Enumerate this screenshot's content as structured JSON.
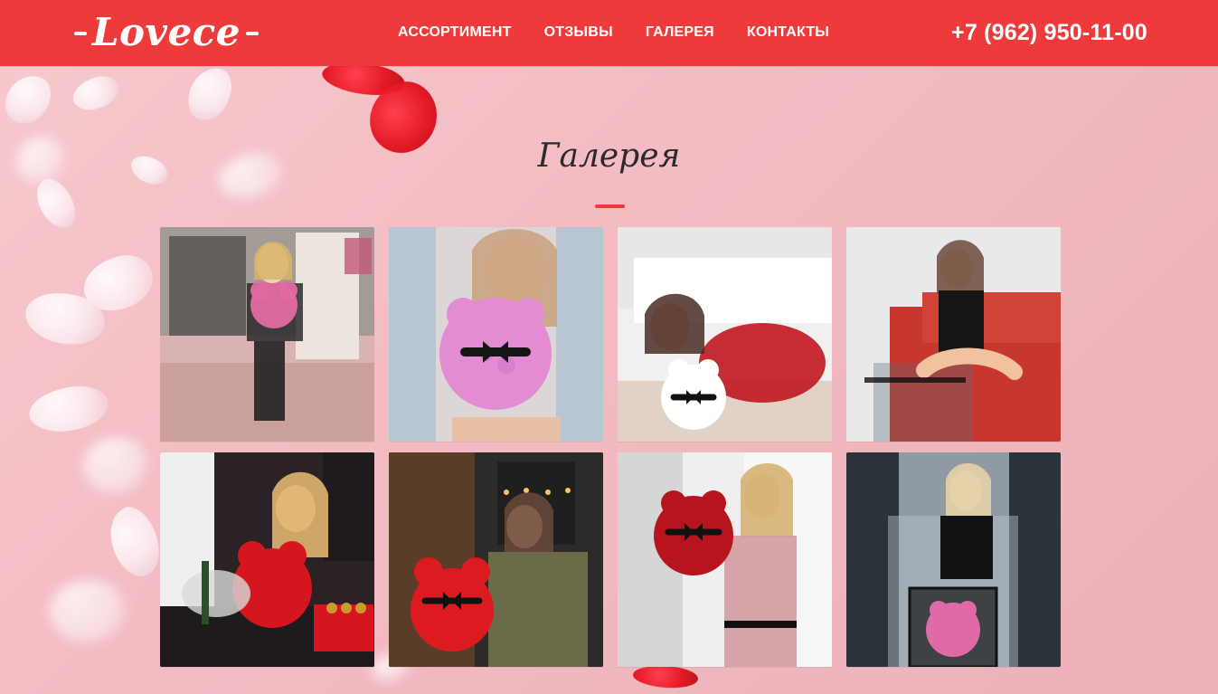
{
  "header": {
    "logo_text": "Lovece",
    "nav": [
      {
        "label": "АССОРТИМЕНТ"
      },
      {
        "label": "ОТЗЫВЫ"
      },
      {
        "label": "ГАЛЕРЕЯ"
      },
      {
        "label": "КОНТАКТЫ"
      }
    ],
    "phone": "+7 (962) 950-11-00"
  },
  "section": {
    "title": "Галерея"
  },
  "gallery": {
    "items": [
      {
        "icon": "gallery-photo"
      },
      {
        "icon": "gallery-photo"
      },
      {
        "icon": "gallery-photo"
      },
      {
        "icon": "gallery-photo"
      },
      {
        "icon": "gallery-photo"
      },
      {
        "icon": "gallery-photo"
      },
      {
        "icon": "gallery-photo"
      },
      {
        "icon": "gallery-photo"
      }
    ]
  },
  "colors": {
    "header_red": "#ef3a3b",
    "background_pink": "#f3bcc3",
    "title_dark": "#2a2a2a"
  }
}
